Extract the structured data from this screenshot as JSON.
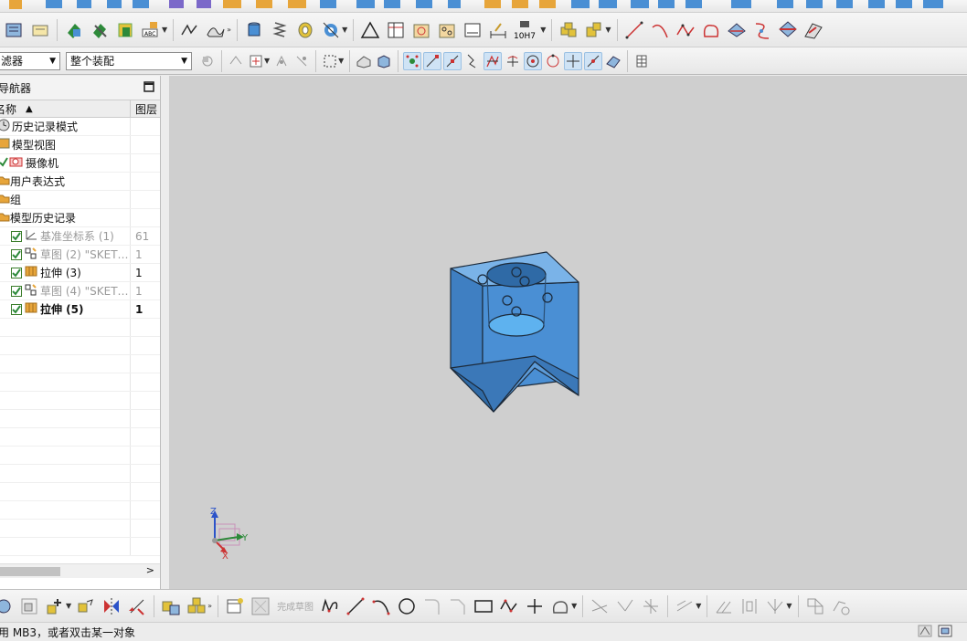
{
  "filter": {
    "selection_filter_value": "滤器",
    "scope_value": "整个装配"
  },
  "navigator": {
    "title": "导航器",
    "col_name": "名称",
    "col_layer": "图层",
    "nodes": [
      {
        "label": "历史记录模式",
        "layer": "",
        "icon": "history-mode-icon"
      },
      {
        "label": "模型视图",
        "layer": "",
        "icon": "model-views-icon"
      },
      {
        "label": "摄像机",
        "layer": "",
        "icon": "camera-icon"
      },
      {
        "label": "用户表达式",
        "layer": "",
        "icon": "expressions-folder-icon"
      },
      {
        "label": "组",
        "layer": "",
        "icon": "groups-folder-icon"
      },
      {
        "label": "模型历史记录",
        "layer": "",
        "icon": "model-history-folder-icon"
      },
      {
        "label": "基准坐标系 (1)",
        "layer": "61",
        "icon": "datum-csys-icon",
        "checked": true,
        "style": "grey"
      },
      {
        "label": "草图 (2) \"SKET…",
        "layer": "1",
        "icon": "sketch-icon",
        "checked": true,
        "style": "grey"
      },
      {
        "label": "拉伸 (3)",
        "layer": "1",
        "icon": "extrude-icon",
        "checked": true,
        "style": "normal"
      },
      {
        "label": "草图 (4) \"SKET…",
        "layer": "1",
        "icon": "sketch-icon",
        "checked": true,
        "style": "grey"
      },
      {
        "label": "拉伸 (5)",
        "layer": "1",
        "icon": "extrude-icon",
        "checked": true,
        "style": "bold"
      }
    ]
  },
  "viewport": {
    "triad": {
      "z": "Z",
      "y": "Y",
      "x": "X"
    }
  },
  "bottom_toolbar": {
    "finish_sketch_label": "完成草图"
  },
  "status": {
    "message": "用 MB3，或者双击某一对象"
  },
  "colors": {
    "model_fill": "#4a8fd4",
    "viewport_bg": "#cfcfcf",
    "select_highlight": "#cfe3f5"
  }
}
